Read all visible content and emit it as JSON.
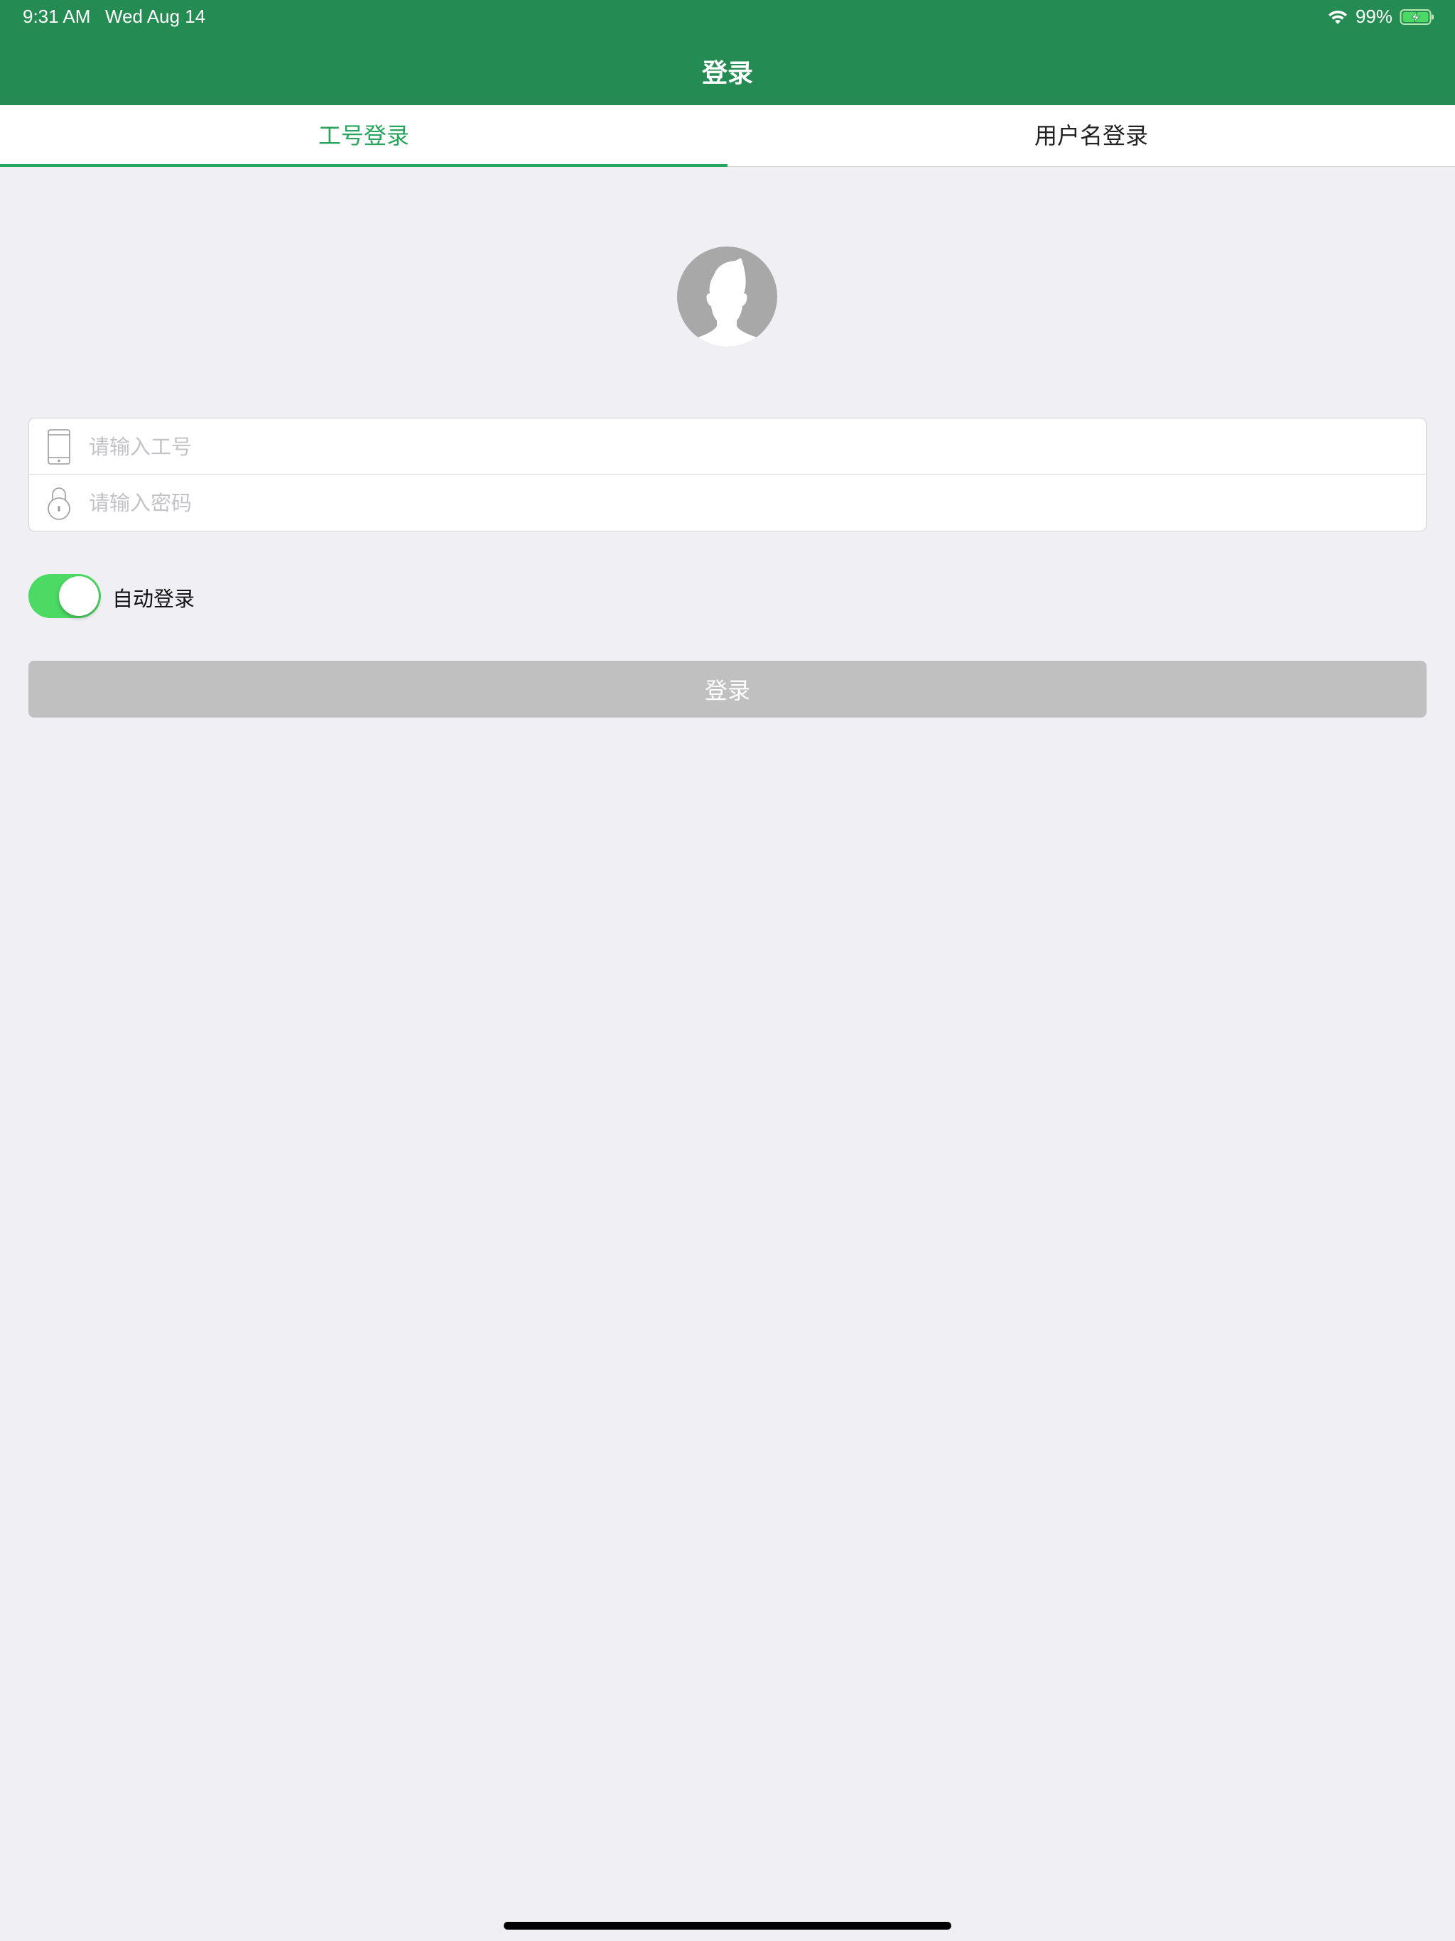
{
  "status_bar": {
    "time": "9:31 AM",
    "date": "Wed Aug 14",
    "battery": "99%",
    "wifi_icon": "wifi-icon",
    "battery_icon": "battery-charging-icon"
  },
  "nav": {
    "title": "登录"
  },
  "tabs": [
    {
      "label": "工号登录",
      "active": true
    },
    {
      "label": "用户名登录",
      "active": false
    }
  ],
  "avatar": {
    "icon": "user-silhouette-icon"
  },
  "form": {
    "employee_id": {
      "placeholder": "请输入工号",
      "value": "",
      "icon": "phone-icon"
    },
    "password": {
      "placeholder": "请输入密码",
      "value": "",
      "icon": "lock-icon"
    }
  },
  "auto_login": {
    "label": "自动登录",
    "enabled": true
  },
  "login_button": {
    "label": "登录"
  },
  "colors": {
    "header": "#248c52",
    "accent": "#27a55c",
    "toggle_on": "#4cd964",
    "button_disabled": "#c0c0c0",
    "background": "#efeff4"
  }
}
